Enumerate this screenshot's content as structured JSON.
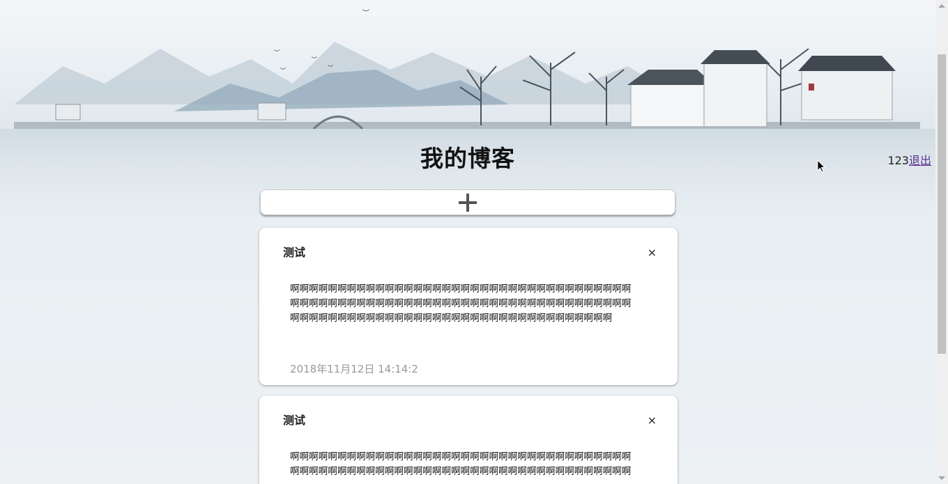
{
  "header": {
    "title": "我的博客",
    "username": "123",
    "logout_label": "退出"
  },
  "add_bar": {
    "icon": "plus-icon"
  },
  "posts": [
    {
      "title": "测试",
      "close_label": "×",
      "body": "啊啊啊啊啊啊啊啊啊啊啊啊啊啊啊啊啊啊啊啊啊啊啊啊啊啊啊啊啊啊啊啊啊啊啊啊啊啊啊啊啊啊啊啊啊啊啊啊啊啊啊啊啊啊啊啊啊啊啊啊啊啊啊啊啊啊啊啊啊啊啊啊啊啊啊啊啊啊啊啊啊啊啊啊啊啊啊啊啊啊啊啊啊啊啊啊啊啊啊啊啊啊啊啊啊啊",
      "date": "2018年11月12日 14:14:2"
    },
    {
      "title": "测试",
      "close_label": "×",
      "body": "啊啊啊啊啊啊啊啊啊啊啊啊啊啊啊啊啊啊啊啊啊啊啊啊啊啊啊啊啊啊啊啊啊啊啊啊啊啊啊啊啊啊啊啊啊啊啊啊啊啊啊啊啊啊啊啊啊啊啊啊啊啊啊啊啊啊啊啊啊啊啊啊",
      "date": ""
    }
  ],
  "colors": {
    "page_bg": "#e6ecf0",
    "card_bg": "#ffffff",
    "date_text": "#999999",
    "logout_link": "#5a2d8c"
  }
}
